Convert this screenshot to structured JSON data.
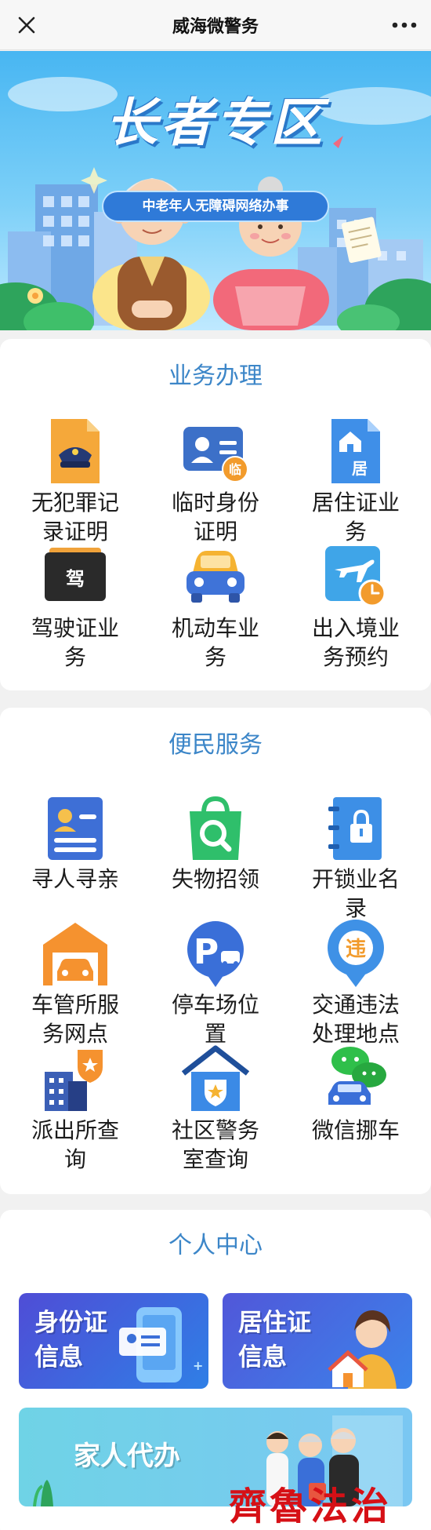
{
  "header": {
    "title": "威海微警务",
    "close_icon": "close-icon",
    "more_icon": "more-icon"
  },
  "banner": {
    "title": "长者专区",
    "subtitle": "中老年人无障碍网络办事"
  },
  "business": {
    "title": "业务办理",
    "items": [
      {
        "label": "无犯罪记录证明",
        "icon": "police-cap-document-icon",
        "color": "#f3a233"
      },
      {
        "label": "临时身份证明",
        "icon": "temporary-id-card-icon",
        "color": "#3c70c8"
      },
      {
        "label": "居住证业务",
        "icon": "residence-permit-icon",
        "color": "#3f8fe8",
        "badge": "居"
      },
      {
        "label": "驾驶证业务",
        "icon": "driver-license-icon",
        "color": "#2b2b2b",
        "badge": "驾"
      },
      {
        "label": "机动车业务",
        "icon": "car-icon",
        "color": "#3f73d8"
      },
      {
        "label": "出入境业务预约",
        "icon": "airplane-clock-icon",
        "color": "#3fa5e8"
      }
    ]
  },
  "convenience": {
    "title": "便民服务",
    "items": [
      {
        "label": "寻人寻亲",
        "icon": "person-card-icon",
        "color": "#3e6fd6"
      },
      {
        "label": "失物招领",
        "icon": "shopping-bag-search-icon",
        "color": "#2fbf6b"
      },
      {
        "label": "开锁业名录",
        "icon": "lock-book-icon",
        "color": "#3d8fe6"
      },
      {
        "label": "车管所服务网点",
        "icon": "garage-car-icon",
        "color": "#f5922f"
      },
      {
        "label": "停车场位置",
        "icon": "parking-pin-icon",
        "color": "#3a6fd8"
      },
      {
        "label": "交通违法处理地点",
        "icon": "violation-pin-icon",
        "color": "#3f91e6",
        "badge": "违"
      },
      {
        "label": "派出所查询",
        "icon": "police-station-icon",
        "color": "#3b5fb6"
      },
      {
        "label": "社区警务室查询",
        "icon": "community-police-house-icon",
        "color": "#3b8ae6"
      },
      {
        "label": "微信挪车",
        "icon": "wechat-car-icon",
        "color": "#2fbf4a"
      }
    ]
  },
  "personal": {
    "title": "个人中心",
    "cards": [
      {
        "label": "身份证信息",
        "line1": "身份证",
        "line2": "信息",
        "icon": "id-phone-icon"
      },
      {
        "label": "居住证信息",
        "line1": "居住证",
        "line2": "信息",
        "icon": "woman-house-icon"
      },
      {
        "label": "家人代办",
        "line1": "家人代办",
        "icon": "family-icon"
      }
    ]
  },
  "watermark": "齊魯法治"
}
